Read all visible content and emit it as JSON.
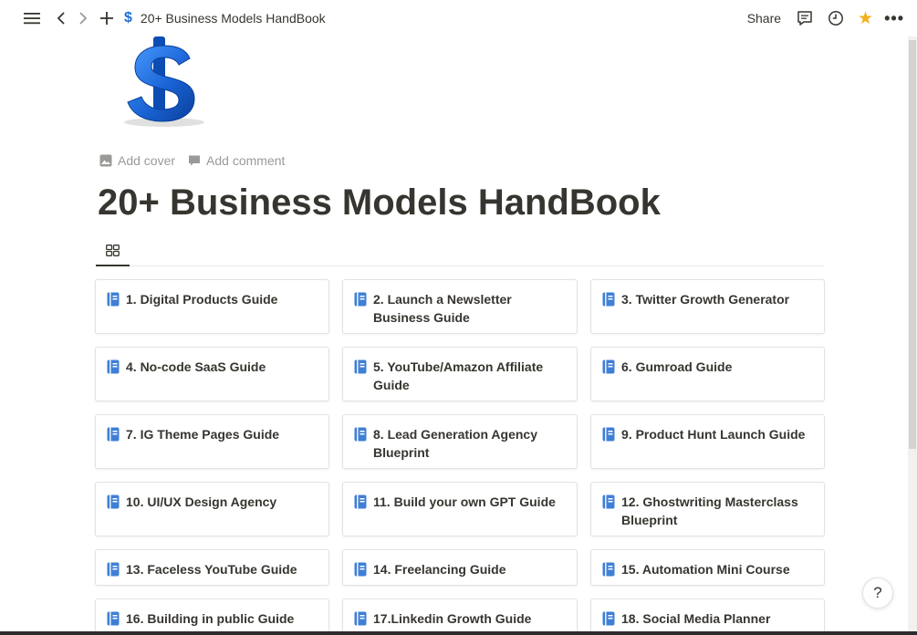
{
  "topbar": {
    "breadcrumb_icon": "$",
    "breadcrumb_title": "20+ Business Models HandBook",
    "share_label": "Share",
    "favorite_color": "#f2b01e",
    "more_label": "•••"
  },
  "page": {
    "icon": "dollar-sign-icon",
    "add_cover_label": "Add cover",
    "add_comment_label": "Add comment",
    "title": "20+ Business Models HandBook"
  },
  "gallery": {
    "cards": [
      {
        "label": "1. Digital Products Guide"
      },
      {
        "label": "2. Launch a Newsletter Business Guide"
      },
      {
        "label": "3. Twitter  Growth Generator"
      },
      {
        "label": "4. No-code SaaS Guide"
      },
      {
        "label": "5. YouTube/Amazon Affiliate Guide"
      },
      {
        "label": "6. Gumroad Guide"
      },
      {
        "label": "7. IG Theme Pages Guide"
      },
      {
        "label": "8. Lead Generation Agency Blueprint"
      },
      {
        "label": "9. Product Hunt Launch Guide"
      },
      {
        "label": "10. UI/UX Design Agency"
      },
      {
        "label": "11. Build your own GPT Guide"
      },
      {
        "label": "12. Ghostwriting Masterclass Blueprint"
      },
      {
        "label": "13.  Faceless YouTube Guide"
      },
      {
        "label": "14. Freelancing Guide"
      },
      {
        "label": "15. Automation Mini Course"
      },
      {
        "label": "16. Building in public Guide"
      },
      {
        "label": "17.Linkedin Growth Guide"
      },
      {
        "label": "18. Social Media Planner"
      }
    ]
  },
  "help": {
    "label": "?"
  }
}
